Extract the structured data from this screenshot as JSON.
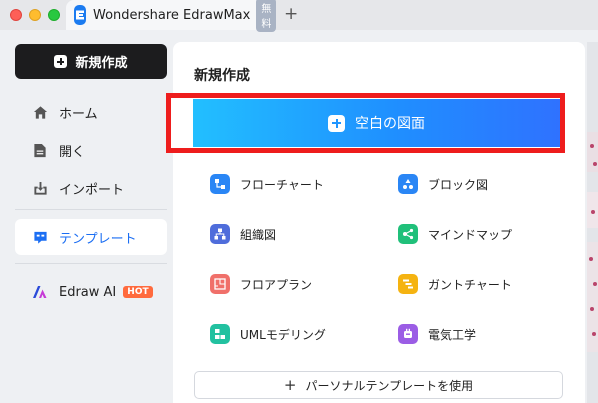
{
  "window": {
    "tab_title": "Wondershare EdrawMax",
    "tab_badge": "無料",
    "new_tab_symbol": "+"
  },
  "sidebar": {
    "new_button_label": "新規作成",
    "items": [
      {
        "label": "ホーム",
        "icon": "home-icon"
      },
      {
        "label": "開く",
        "icon": "document-icon"
      },
      {
        "label": "インポート",
        "icon": "import-icon"
      },
      {
        "label": "テンプレート",
        "icon": "template-icon",
        "selected": true
      },
      {
        "label": "Edraw AI",
        "icon": "edraw-ai-icon",
        "badge": "HOT"
      }
    ]
  },
  "main": {
    "title": "新規作成",
    "blank_button_label": "空白の図面",
    "templates": [
      {
        "label": "フローチャート",
        "icon": "flowchart-icon",
        "color": "#2a86f5"
      },
      {
        "label": "ブロック図",
        "icon": "block-diagram-icon",
        "color": "#2a86f5"
      },
      {
        "label": "組織図",
        "icon": "org-chart-icon",
        "color": "#4f6ddb"
      },
      {
        "label": "マインドマップ",
        "icon": "mindmap-icon",
        "color": "#20c07a"
      },
      {
        "label": "フロアプラン",
        "icon": "floor-plan-icon",
        "color": "#f0706a"
      },
      {
        "label": "ガントチャート",
        "icon": "gantt-chart-icon",
        "color": "#f5b311"
      },
      {
        "label": "UMLモデリング",
        "icon": "uml-icon",
        "color": "#22c1a0"
      },
      {
        "label": "電気工学",
        "icon": "electrical-icon",
        "color": "#9b5de5"
      }
    ],
    "personal_template_symbol": "+",
    "personal_template_label": "パーソナルテンプレートを使用"
  },
  "colors": {
    "accent": "#1b6ef3",
    "highlight_border": "#ee1d1d",
    "new_button_bg": "#1c1c1e",
    "hot_badge": "#ff6a3d"
  }
}
